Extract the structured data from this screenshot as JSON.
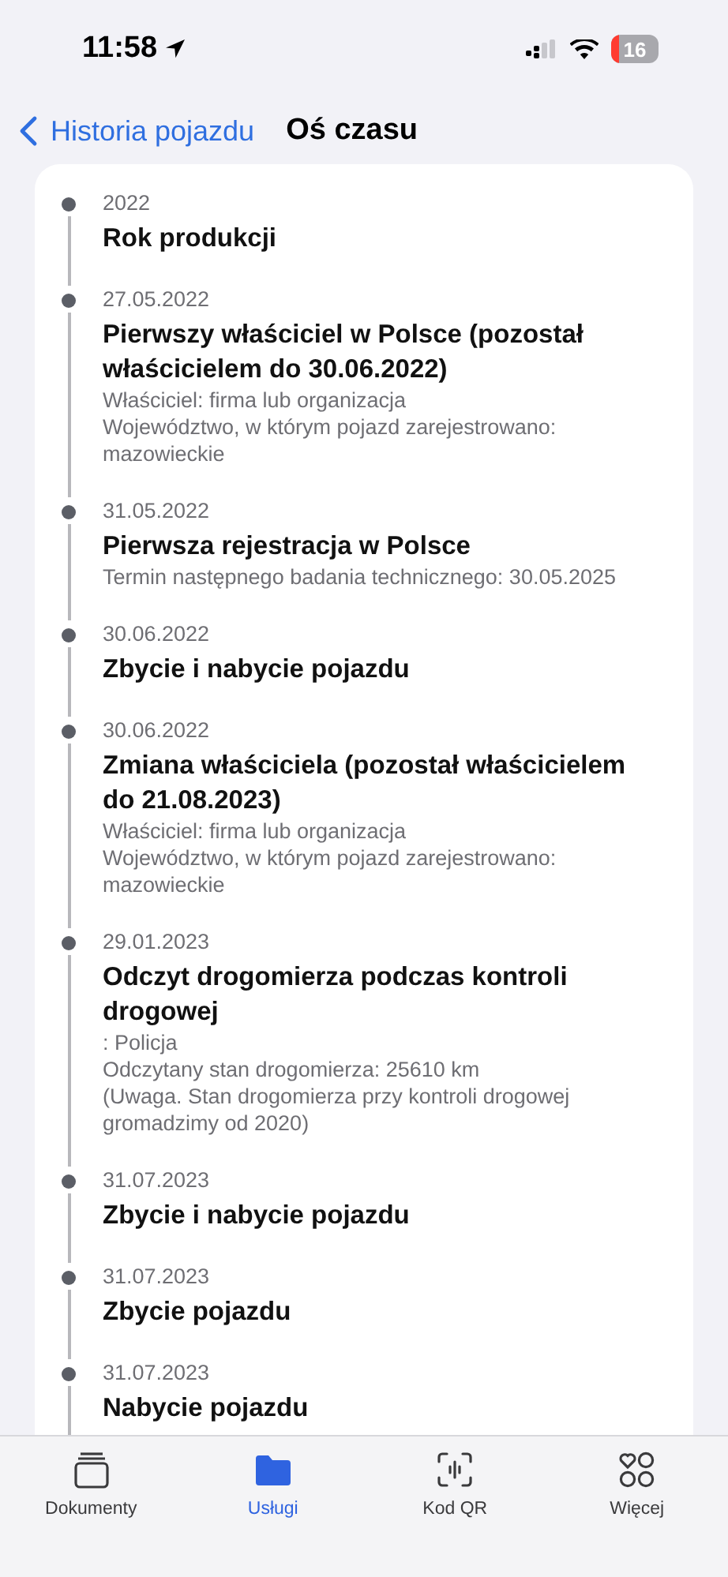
{
  "status_bar": {
    "time": "11:58",
    "battery": "16"
  },
  "nav": {
    "back": "Historia pojazdu",
    "title": "Oś czasu"
  },
  "timeline": [
    {
      "date": "2022",
      "title": "Rok produkcji"
    },
    {
      "date": "27.05.2022",
      "title": "Pierwszy właściciel w Polsce (pozostał właścicielem do 30.06.2022)",
      "details": [
        "Właściciel: firma lub organizacja",
        "Województwo, w którym pojazd zarejestrowano: mazowieckie"
      ]
    },
    {
      "date": "31.05.2022",
      "title": "Pierwsza rejestracja w Polsce",
      "details": [
        "Termin następnego badania technicznego: 30.05.2025"
      ]
    },
    {
      "date": "30.06.2022",
      "title": "Zbycie i nabycie pojazdu"
    },
    {
      "date": "30.06.2022",
      "title": "Zmiana właściciela (pozostał właścicielem do 21.08.2023)",
      "details": [
        "Właściciel: firma lub organizacja",
        "Województwo, w którym pojazd zarejestrowano: mazowieckie"
      ]
    },
    {
      "date": "29.01.2023",
      "title": "Odczyt drogomierza podczas kontroli drogowej",
      "details": [
        ": Policja",
        "Odczytany stan drogomierza: 25610 km",
        "(Uwaga. Stan drogomierza przy kontroli drogowej gromadzimy od 2020)"
      ]
    },
    {
      "date": "31.07.2023",
      "title": "Zbycie i nabycie pojazdu"
    },
    {
      "date": "31.07.2023",
      "title": "Zbycie pojazdu"
    },
    {
      "date": "31.07.2023",
      "title": "Nabycie pojazdu"
    }
  ],
  "tab_bar": [
    {
      "kind": "documents",
      "label": "Dokumenty",
      "selected": false
    },
    {
      "kind": "services",
      "label": "Usługi",
      "selected": true
    },
    {
      "kind": "qr",
      "label": "Kod QR",
      "selected": false
    },
    {
      "kind": "more",
      "label": "Więcej",
      "selected": false
    }
  ]
}
